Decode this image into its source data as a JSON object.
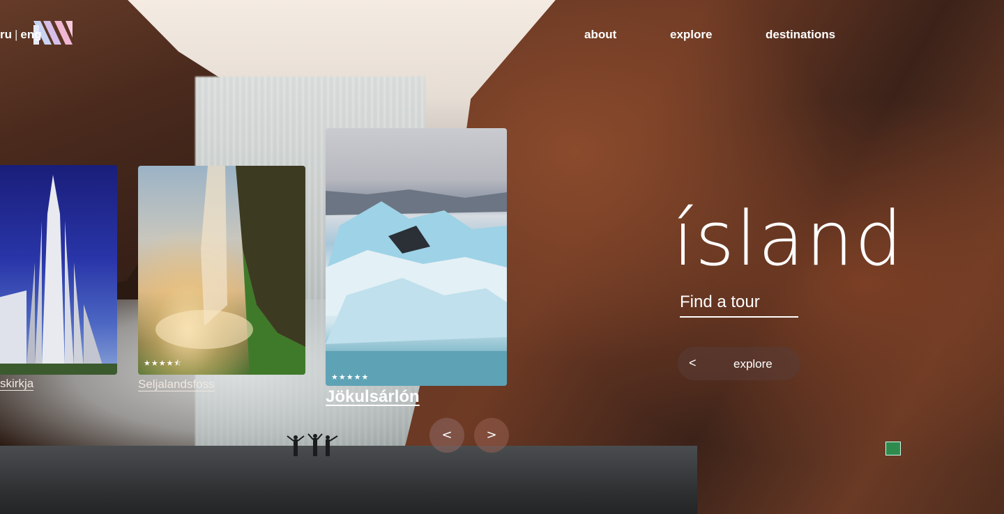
{
  "nav": {
    "about": "about",
    "explore": "explore",
    "destinations": "destinations",
    "lang_ru": "ru",
    "lang_sep": "|",
    "lang_eng": "eng"
  },
  "hero": {
    "title": "ísland",
    "find_tour": "Find a tour",
    "explore_button": "explore",
    "explore_chevron": "<"
  },
  "cards": [
    {
      "label": "skirkja",
      "rating": null
    },
    {
      "label": "Seljalandsfoss",
      "rating": 4.5,
      "stars_text": "★★★★⯪"
    },
    {
      "label": "Jökulsárlón",
      "rating": 5,
      "stars_text": "★★★★★"
    }
  ],
  "carousel": {
    "prev": "<",
    "next": ">"
  },
  "icons": {
    "logo": "logo-icon",
    "prev": "chevron-left-icon",
    "next": "chevron-right-icon"
  }
}
